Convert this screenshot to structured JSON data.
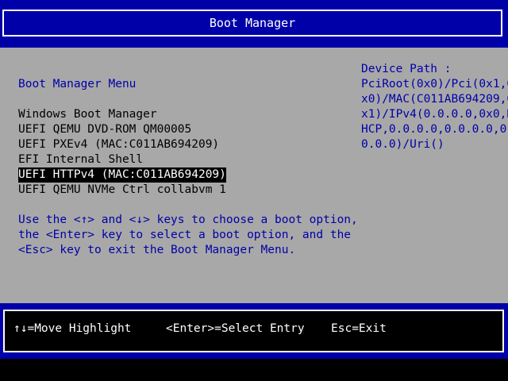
{
  "header": {
    "title": "Boot Manager"
  },
  "main": {
    "menu_title": "Boot Manager Menu",
    "boot_options": [
      "Windows Boot Manager",
      "UEFI QEMU DVD-ROM QM00005",
      "UEFI PXEv4 (MAC:C011AB694209)",
      "EFI Internal Shell",
      "UEFI HTTPv4 (MAC:C011AB694209)",
      "UEFI QEMU NVMe Ctrl collabvm 1"
    ],
    "selected_index": 4,
    "instructions": [
      "Use the <↑> and <↓> keys to choose a boot option,",
      "the <Enter> key to select a boot option, and the",
      "<Esc> key to exit the Boot Manager Menu."
    ]
  },
  "device_path": {
    "label": "Device Path :",
    "lines": [
      "PciRoot(0x0)/Pci(0x1,0",
      "x0)/MAC(C011AB694209,0",
      "x1)/IPv4(0.0.0.0,0x0,D",
      "HCP,0.0.0.0,0.0.0.0,0.",
      "0.0.0)/Uri()"
    ]
  },
  "footer": {
    "move_highlight": "↑↓=Move Highlight",
    "select_entry": "<Enter>=Select Entry",
    "exit": "Esc=Exit"
  },
  "colors": {
    "band": "#0000a8",
    "panel": "#a8a8a8",
    "highlight_bg": "#000000",
    "highlight_fg": "#ffffff",
    "help_text": "#0000a8"
  }
}
